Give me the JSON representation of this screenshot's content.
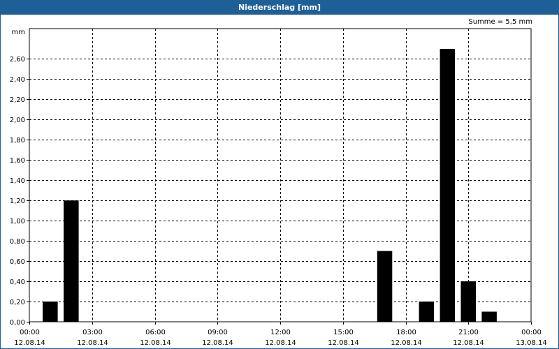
{
  "window": {
    "title": "Niederschlag [mm]"
  },
  "summary": "Summe = 5,5 mm",
  "chart_data": {
    "type": "bar",
    "title": "Niederschlag [mm]",
    "ylabel": "mm",
    "ylim": [
      0,
      2.9
    ],
    "y_ticks": [
      {
        "v": 0,
        "label": "0,00"
      },
      {
        "v": 0.2,
        "label": "0,20"
      },
      {
        "v": 0.4,
        "label": "0,40"
      },
      {
        "v": 0.6,
        "label": "0,60"
      },
      {
        "v": 0.8,
        "label": "0,80"
      },
      {
        "v": 1.0,
        "label": "1,00"
      },
      {
        "v": 1.2,
        "label": "1,20"
      },
      {
        "v": 1.4,
        "label": "1,40"
      },
      {
        "v": 1.6,
        "label": "1,60"
      },
      {
        "v": 1.8,
        "label": "1,80"
      },
      {
        "v": 2.0,
        "label": "2,00"
      },
      {
        "v": 2.2,
        "label": "2,20"
      },
      {
        "v": 2.4,
        "label": "2,40"
      },
      {
        "v": 2.6,
        "label": "2,60"
      }
    ],
    "xlim_hours": [
      0,
      24
    ],
    "x_ticks": [
      {
        "h": 0,
        "time": "00:00",
        "date": "12.08.14"
      },
      {
        "h": 3,
        "time": "03:00",
        "date": "12.08.14"
      },
      {
        "h": 6,
        "time": "06:00",
        "date": "12.08.14"
      },
      {
        "h": 9,
        "time": "09:00",
        "date": "12.08.14"
      },
      {
        "h": 12,
        "time": "12:00",
        "date": "12.08.14"
      },
      {
        "h": 15,
        "time": "15:00",
        "date": "12.08.14"
      },
      {
        "h": 18,
        "time": "18:00",
        "date": "12.08.14"
      },
      {
        "h": 21,
        "time": "21:00",
        "date": "12.08.14"
      },
      {
        "h": 24,
        "time": "00:00",
        "date": "13.08.14"
      }
    ],
    "bars": [
      {
        "hour": 1,
        "value": 0.2
      },
      {
        "hour": 2,
        "value": 1.2
      },
      {
        "hour": 17,
        "value": 0.7
      },
      {
        "hour": 19,
        "value": 0.2
      },
      {
        "hour": 20,
        "value": 2.7
      },
      {
        "hour": 21,
        "value": 0.4
      },
      {
        "hour": 22,
        "value": 0.1
      }
    ],
    "bar_color": "#000000",
    "grid": true
  }
}
